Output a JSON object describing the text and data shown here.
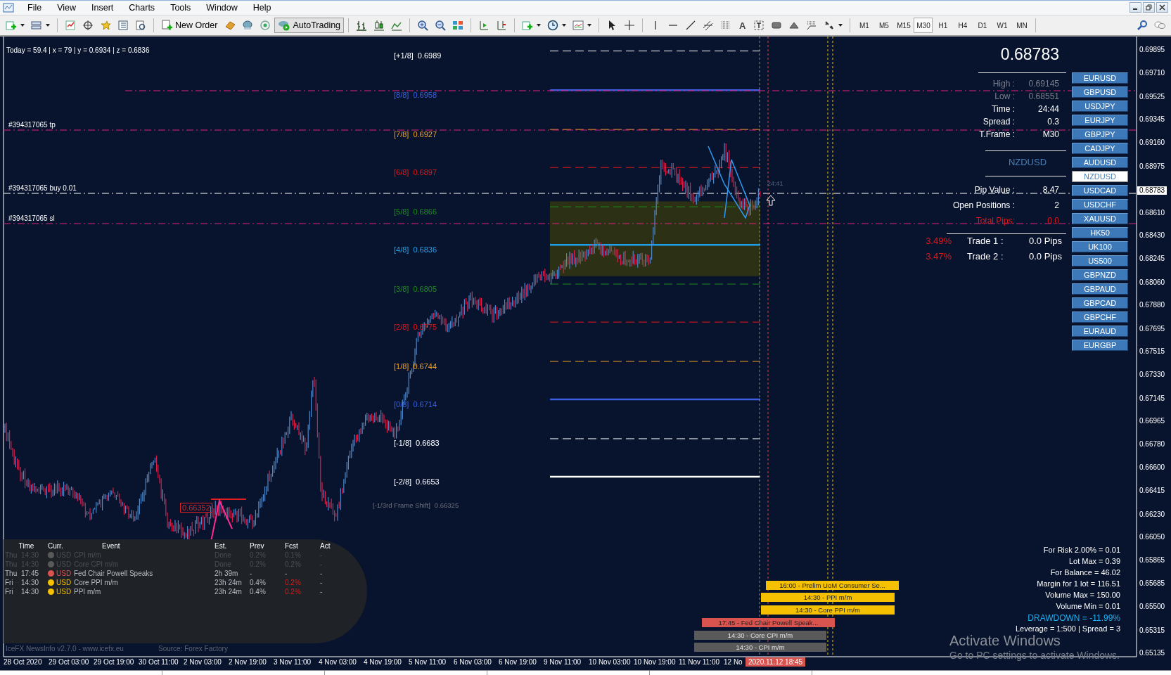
{
  "menu": {
    "items": [
      "File",
      "View",
      "Insert",
      "Charts",
      "Tools",
      "Window",
      "Help"
    ]
  },
  "toolbar": {
    "new_order": "New Order",
    "autotrading": {
      "label": "AutoTrading",
      "on": true
    },
    "text_tool": "A",
    "timeframes": [
      {
        "label": "M1",
        "selected": false
      },
      {
        "label": "M5",
        "selected": false
      },
      {
        "label": "M15",
        "selected": false
      },
      {
        "label": "M30",
        "selected": true
      },
      {
        "label": "H1",
        "selected": false
      },
      {
        "label": "H4",
        "selected": false
      },
      {
        "label": "D1",
        "selected": false
      },
      {
        "label": "W1",
        "selected": false
      },
      {
        "label": "MN",
        "selected": false
      }
    ]
  },
  "chart": {
    "info_line": "Today = 59.4  |  x = 79  |  y = 0.6934  |  z = 0.6836",
    "order_lines": [
      {
        "label": "#394317065 tp",
        "kind": "tp"
      },
      {
        "label": "#394317065 buy 0.01",
        "kind": "buy"
      },
      {
        "label": "#394317065 sl",
        "kind": "sl"
      }
    ],
    "murrey_levels": [
      {
        "label": "[+1/8]",
        "value": "0.6989",
        "color": "#ffffff",
        "kind": "dashed"
      },
      {
        "label": "[8/8]",
        "value": "0.6958",
        "color": "#3c5fe0",
        "kind": "solid"
      },
      {
        "label": "[7/8]",
        "value": "0.6927",
        "color": "#f0a020",
        "kind": "dashed"
      },
      {
        "label": "[6/8]",
        "value": "0.6897",
        "color": "#e01818",
        "kind": "dashed"
      },
      {
        "label": "[5/8]",
        "value": "0.6866",
        "color": "#1e8a1e",
        "kind": "dashed"
      },
      {
        "label": "[4/8]",
        "value": "0.6836",
        "color": "#1ea0e8",
        "kind": "solid"
      },
      {
        "label": "[3/8]",
        "value": "0.6805",
        "color": "#1e8a1e",
        "kind": "dashed"
      },
      {
        "label": "[2/8]",
        "value": "0.6775",
        "color": "#e01818",
        "kind": "dashed"
      },
      {
        "label": "[1/8]",
        "value": "0.6744",
        "color": "#f0a020",
        "kind": "dashed"
      },
      {
        "label": "[0/8]",
        "value": "0.6714",
        "color": "#3c5fe0",
        "kind": "solid"
      },
      {
        "label": "[-1/8]",
        "value": "0.6683",
        "color": "#ffffff",
        "kind": "dashed"
      },
      {
        "label": "[-2/8]",
        "value": "0.6653",
        "color": "#ffffff",
        "kind": "solid"
      }
    ],
    "frame_shift": {
      "label": "[-1/3rd Frame Shift]",
      "value": "0.66325"
    },
    "price_tag": "0.66352",
    "countdown": "24:41"
  },
  "info_panel": {
    "price": "0.68783",
    "stats": [
      {
        "label": "High :",
        "value": "0.69145",
        "dim": true
      },
      {
        "label": "Low :",
        "value": "0.68551",
        "dim": true
      },
      {
        "label": "Time :",
        "value": "24:44",
        "dim": false
      },
      {
        "label": "Spread :",
        "value": "0.3",
        "dim": false
      },
      {
        "label": "T.Frame :",
        "value": "M30",
        "dim": false
      }
    ],
    "symbol": "NZDUSD",
    "positions": [
      {
        "label": "Pip Value :",
        "value": "8.47",
        "kind": "normal"
      },
      {
        "label": "Open Positions :",
        "value": "2",
        "kind": "normal"
      },
      {
        "label": "Total Pips:",
        "value": "0.0",
        "kind": "alert"
      }
    ],
    "trades": [
      {
        "percent": "3.49%",
        "label": "Trade 1 :",
        "value": "0.0 Pips"
      },
      {
        "percent": "3.47%",
        "label": "Trade 2 :",
        "value": "0.0 Pips"
      }
    ]
  },
  "symbols": [
    {
      "label": "EURUSD",
      "selected": false
    },
    {
      "label": "GBPUSD",
      "selected": false
    },
    {
      "label": "USDJPY",
      "selected": false
    },
    {
      "label": "EURJPY",
      "selected": false
    },
    {
      "label": "GBPJPY",
      "selected": false
    },
    {
      "label": "CADJPY",
      "selected": false
    },
    {
      "label": "AUDUSD",
      "selected": false
    },
    {
      "label": "NZDUSD",
      "selected": true
    },
    {
      "label": "USDCAD",
      "selected": false
    },
    {
      "label": "USDCHF",
      "selected": false
    },
    {
      "label": "XAUUSD",
      "selected": false
    },
    {
      "label": "HK50",
      "selected": false
    },
    {
      "label": "UK100",
      "selected": false
    },
    {
      "label": "US500",
      "selected": false
    },
    {
      "label": "GBPNZD",
      "selected": false
    },
    {
      "label": "GBPAUD",
      "selected": false
    },
    {
      "label": "GBPCAD",
      "selected": false
    },
    {
      "label": "GBPCHF",
      "selected": false
    },
    {
      "label": "EURAUD",
      "selected": false
    },
    {
      "label": "EURGBP",
      "selected": false
    }
  ],
  "risk_lines": [
    {
      "text": "For Risk 2.00% = 0.01",
      "kind": "normal"
    },
    {
      "text": "Lot Max = 0.39",
      "kind": "normal"
    },
    {
      "text": "For Balance = 46.02",
      "kind": "normal"
    },
    {
      "text": "Margin for 1 lot = 116.51",
      "kind": "normal"
    },
    {
      "text": "Volume Max = 150.00",
      "kind": "normal"
    },
    {
      "text": "Volume Min = 0.01",
      "kind": "normal"
    },
    {
      "text": "DRAWDOWN = -11.99%",
      "kind": "drawdown"
    },
    {
      "text": "Leverage = 1:500 | Spread = 3",
      "kind": "normal"
    }
  ],
  "event_bars": [
    {
      "text": "16:00 - Prelim UoM Consumer Se...",
      "color": "#f5c000"
    },
    {
      "text": "14:30 - PPI m/m",
      "color": "#f5c000"
    },
    {
      "text": "14:30 - Core PPI m/m",
      "color": "#f5c000"
    },
    {
      "text": "17:45 - Fed Chair Powell Speak...",
      "color": "#d9534f"
    },
    {
      "text": "14:30 - Core CPI m/m",
      "color": "#5a5a5a"
    },
    {
      "text": "14:30 - CPI m/m",
      "color": "#5a5a5a"
    }
  ],
  "price_axis": {
    "labels": [
      "0.69895",
      "0.69710",
      "0.69525",
      "0.69345",
      "0.69160",
      "0.68975",
      "0.68610",
      "0.68430",
      "0.68245",
      "0.68060",
      "0.67880",
      "0.67695",
      "0.67515",
      "0.67330",
      "0.67145",
      "0.66965",
      "0.66780",
      "0.66600",
      "0.66415",
      "0.66230",
      "0.66050",
      "0.65865",
      "0.65685",
      "0.65500",
      "0.65315",
      "0.65135"
    ],
    "current": "0.68783"
  },
  "time_axis": {
    "labels": [
      "28 Oct 2020",
      "29 Oct 03:00",
      "29 Oct 19:00",
      "30 Oct 11:00",
      "2 Nov 03:00",
      "2 Nov 19:00",
      "3 Nov 11:00",
      "4 Nov 03:00",
      "4 Nov 19:00",
      "5 Nov 11:00",
      "6 Nov 03:00",
      "6 Nov 19:00",
      "9 Nov 11:00",
      "10 Nov 03:00",
      "10 Nov 19:00",
      "11 Nov 11:00",
      "12 No"
    ],
    "cursor_time": "2020.11.12 18:45"
  },
  "news": {
    "columns": [
      "Time",
      "Curr.",
      "Event",
      "Est.",
      "Prev",
      "Fcst",
      "Act"
    ],
    "rows": [
      {
        "day": "Thu",
        "time": "14:30",
        "color": "#5a5a5a",
        "currency": "USD",
        "event": "CPI m/m",
        "est": "Done",
        "prev": "0.2%",
        "fcst": "0.1%",
        "act": "-",
        "done": true,
        "fcst_alert": false
      },
      {
        "day": "Thu",
        "time": "14:30",
        "color": "#5a5a5a",
        "currency": "USD",
        "event": "Core CPI m/m",
        "est": "Done",
        "prev": "0.2%",
        "fcst": "0.2%",
        "act": "-",
        "done": true,
        "fcst_alert": false
      },
      {
        "day": "Thu",
        "time": "17:45",
        "color": "#d9534f",
        "currency": "USD",
        "event": "Fed Chair Powell Speaks",
        "est": "2h 39m",
        "prev": "-",
        "fcst": "-",
        "act": "-",
        "done": false,
        "fcst_alert": false
      },
      {
        "day": "Fri",
        "time": "14:30",
        "color": "#f5c000",
        "currency": "USD",
        "event": "Core PPI m/m",
        "est": "23h 24m",
        "prev": "0.4%",
        "fcst": "0.2%",
        "act": "-",
        "done": false,
        "fcst_alert": true
      },
      {
        "day": "Fri",
        "time": "14:30",
        "color": "#f5c000",
        "currency": "USD",
        "event": "PPI m/m",
        "est": "23h 24m",
        "prev": "0.4%",
        "fcst": "0.2%",
        "act": "-",
        "done": false,
        "fcst_alert": true
      }
    ],
    "footer": "IceFX NewsInfo v2.7.0  -  www.icefx.eu",
    "source": "Source: Forex Factory"
  },
  "os_notice": {
    "title": "Activate Windows",
    "subtitle": "Go to PC settings to activate Windows."
  }
}
